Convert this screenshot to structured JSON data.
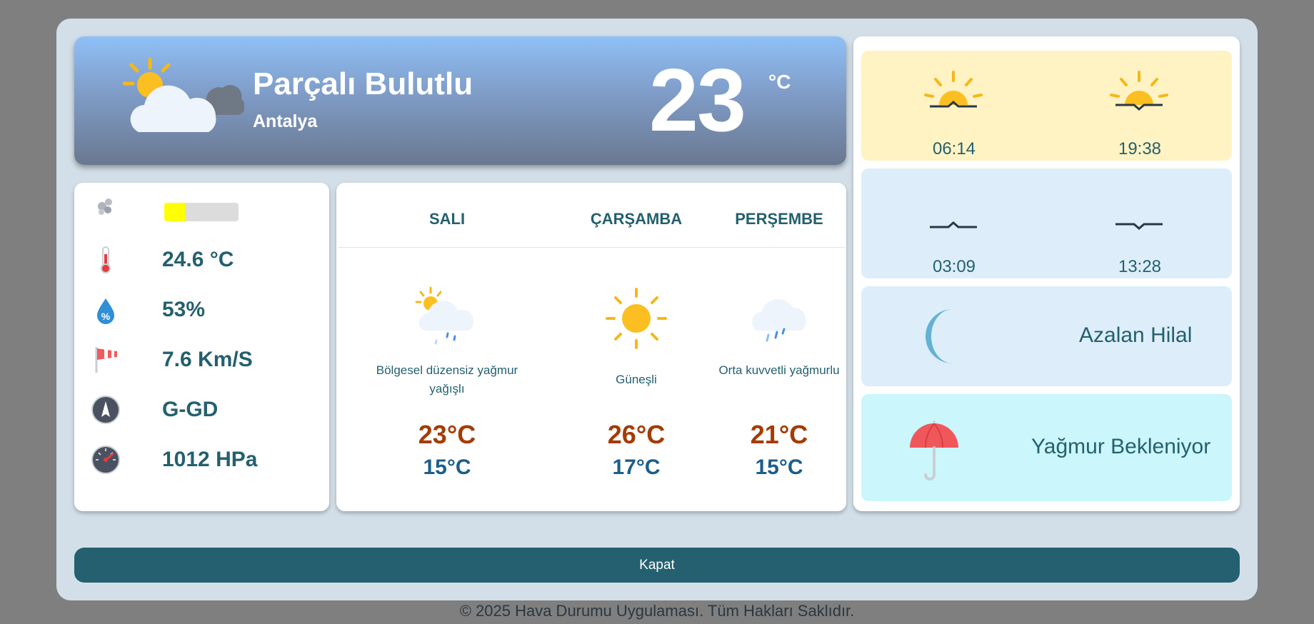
{
  "current": {
    "condition": "Parçalı Bulutlu",
    "city": "Antalya",
    "temperature": "23",
    "unit": "°C",
    "icon": "partly-cloudy-icon"
  },
  "stats": {
    "air_quality_level": 0.28,
    "air_quality_color": "#ffff00",
    "temperature": "24.6 °C",
    "humidity": "53%",
    "wind_speed": "7.6 Km/S",
    "wind_direction": "G-GD",
    "pressure": "1012 HPa"
  },
  "forecast": [
    {
      "day": "SALI",
      "desc": "Bölgesel düzensiz yağmur yağışlı",
      "high": "23°C",
      "low": "15°C",
      "icon": "sun-cloud-rain-icon"
    },
    {
      "day": "ÇARŞAMBA",
      "desc": "Güneşli",
      "high": "26°C",
      "low": "17°C",
      "icon": "sun-icon"
    },
    {
      "day": "PERŞEMBE",
      "desc": "Orta kuvvetli yağmurlu",
      "high": "21°C",
      "low": "15°C",
      "icon": "rain-cloud-icon"
    }
  ],
  "sun": {
    "sunrise": "06:14",
    "sunset": "19:38"
  },
  "moon": {
    "moonrise": "03:09",
    "moonset": "13:28"
  },
  "moon_phase": {
    "name": "Azalan Hilal",
    "icon": "waning-crescent-icon"
  },
  "rain": {
    "status": "Yağmur Bekleniyor",
    "icon": "umbrella-icon"
  },
  "close_label": "Kapat",
  "footer": "© 2025 Hava Durumu Uygulaması. Tüm Hakları Saklıdır.",
  "colors": {
    "accent": "#24606f",
    "high_temp": "#a33c05",
    "low_temp": "#1b5e8c",
    "sun_tile": "#fff3c4",
    "moon_tile": "#ddeefa",
    "rain_tile": "#cbf6fb"
  }
}
